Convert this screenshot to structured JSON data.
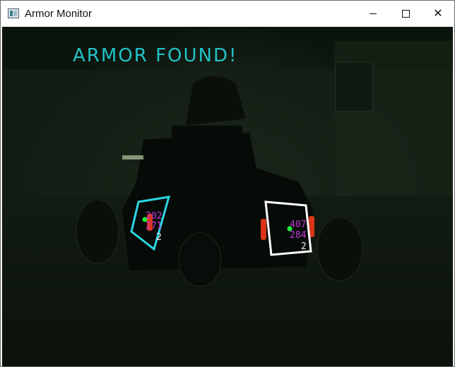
{
  "window": {
    "title": "Armor Monitor",
    "icon": "app-window-icon",
    "controls": {
      "minimize": "minimize",
      "maximize": "maximize",
      "close": "close"
    }
  },
  "viewport": {
    "status_text": "ARMOR FOUND!",
    "status_color": "#22c2c7",
    "detections": [
      {
        "box_color": "#2ad6e3",
        "center_color": "#1dff3c",
        "x": "202",
        "y": "271",
        "id": "2"
      },
      {
        "box_color": "#ffffff",
        "center_color": "#1dff3c",
        "x": "407",
        "y": "284",
        "id": "2"
      }
    ]
  }
}
